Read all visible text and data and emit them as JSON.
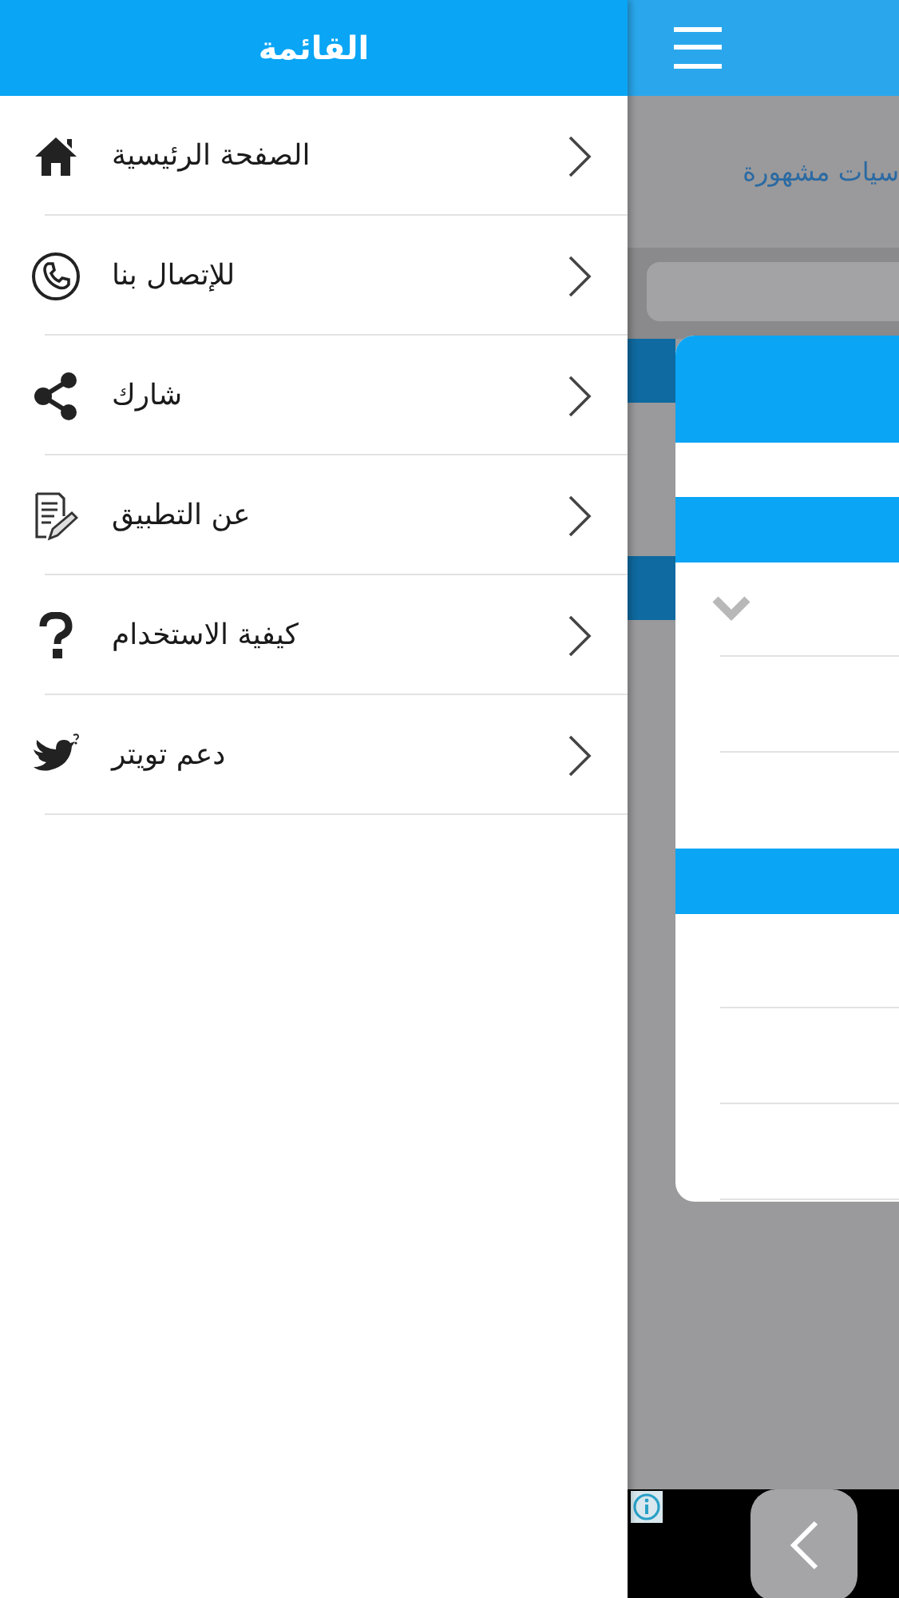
{
  "drawer": {
    "title": "القائمة",
    "items": [
      {
        "label": "الصفحة الرئيسية"
      },
      {
        "label": "للإتصال بنا"
      },
      {
        "label": "شارك"
      },
      {
        "label": "عن التطبيق"
      },
      {
        "label": "كيفية الاستخدام"
      },
      {
        "label": "دعم تويتر"
      }
    ]
  },
  "background": {
    "heading": "سيات مشهورة"
  }
}
